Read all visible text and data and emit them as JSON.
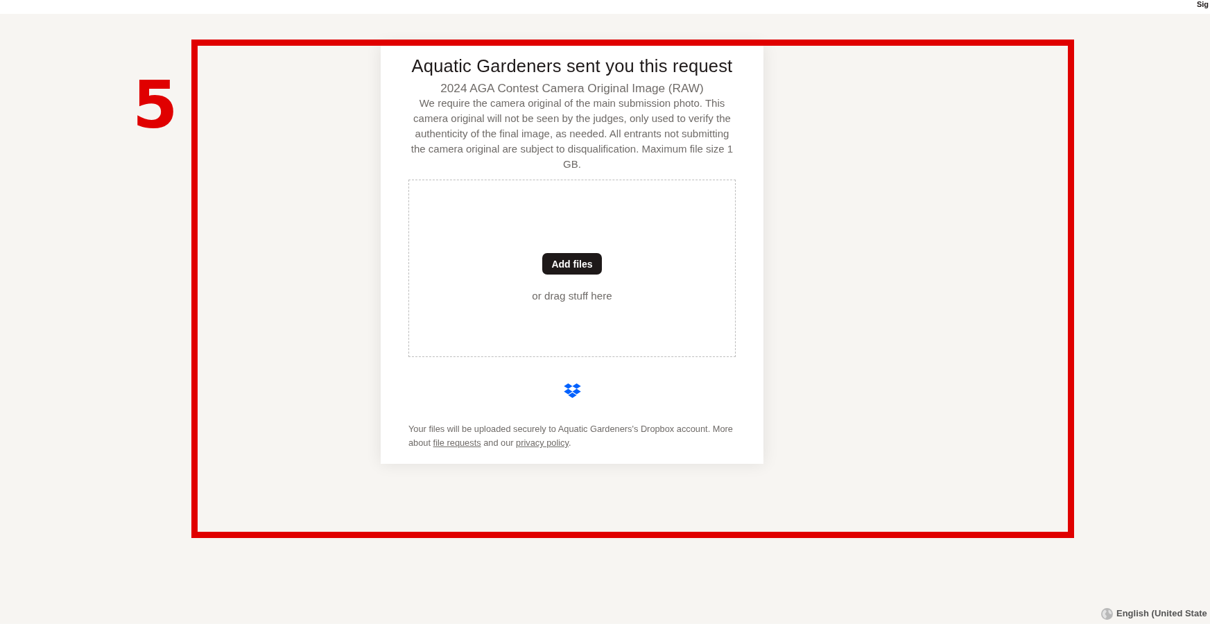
{
  "header": {
    "sign_in": "Sig"
  },
  "request": {
    "title": "Aquatic Gardeners sent you this request",
    "subtitle": "2024 AGA Contest Camera Original Image (RAW)",
    "description": "We require the camera original of the main submission photo. This camera original will not be seen by the judges, only used to verify the authenticity of the final image, as needed. All entrants not submitting the camera original are subject to disqualification. Maximum file size 1 GB.",
    "dropzone": {
      "button": "Add files",
      "hint": "or drag stuff here"
    },
    "notice": [
      {
        "kind": "text",
        "text": "Your files will be uploaded securely to Aquatic Gardeners's Dropbox account. More about "
      },
      {
        "kind": "link",
        "text": "file requests"
      },
      {
        "kind": "text",
        "text": " and our "
      },
      {
        "kind": "link",
        "text": "privacy policy"
      },
      {
        "kind": "text",
        "text": "."
      }
    ]
  },
  "language": "English (United State",
  "annotation": {
    "label": "5"
  }
}
